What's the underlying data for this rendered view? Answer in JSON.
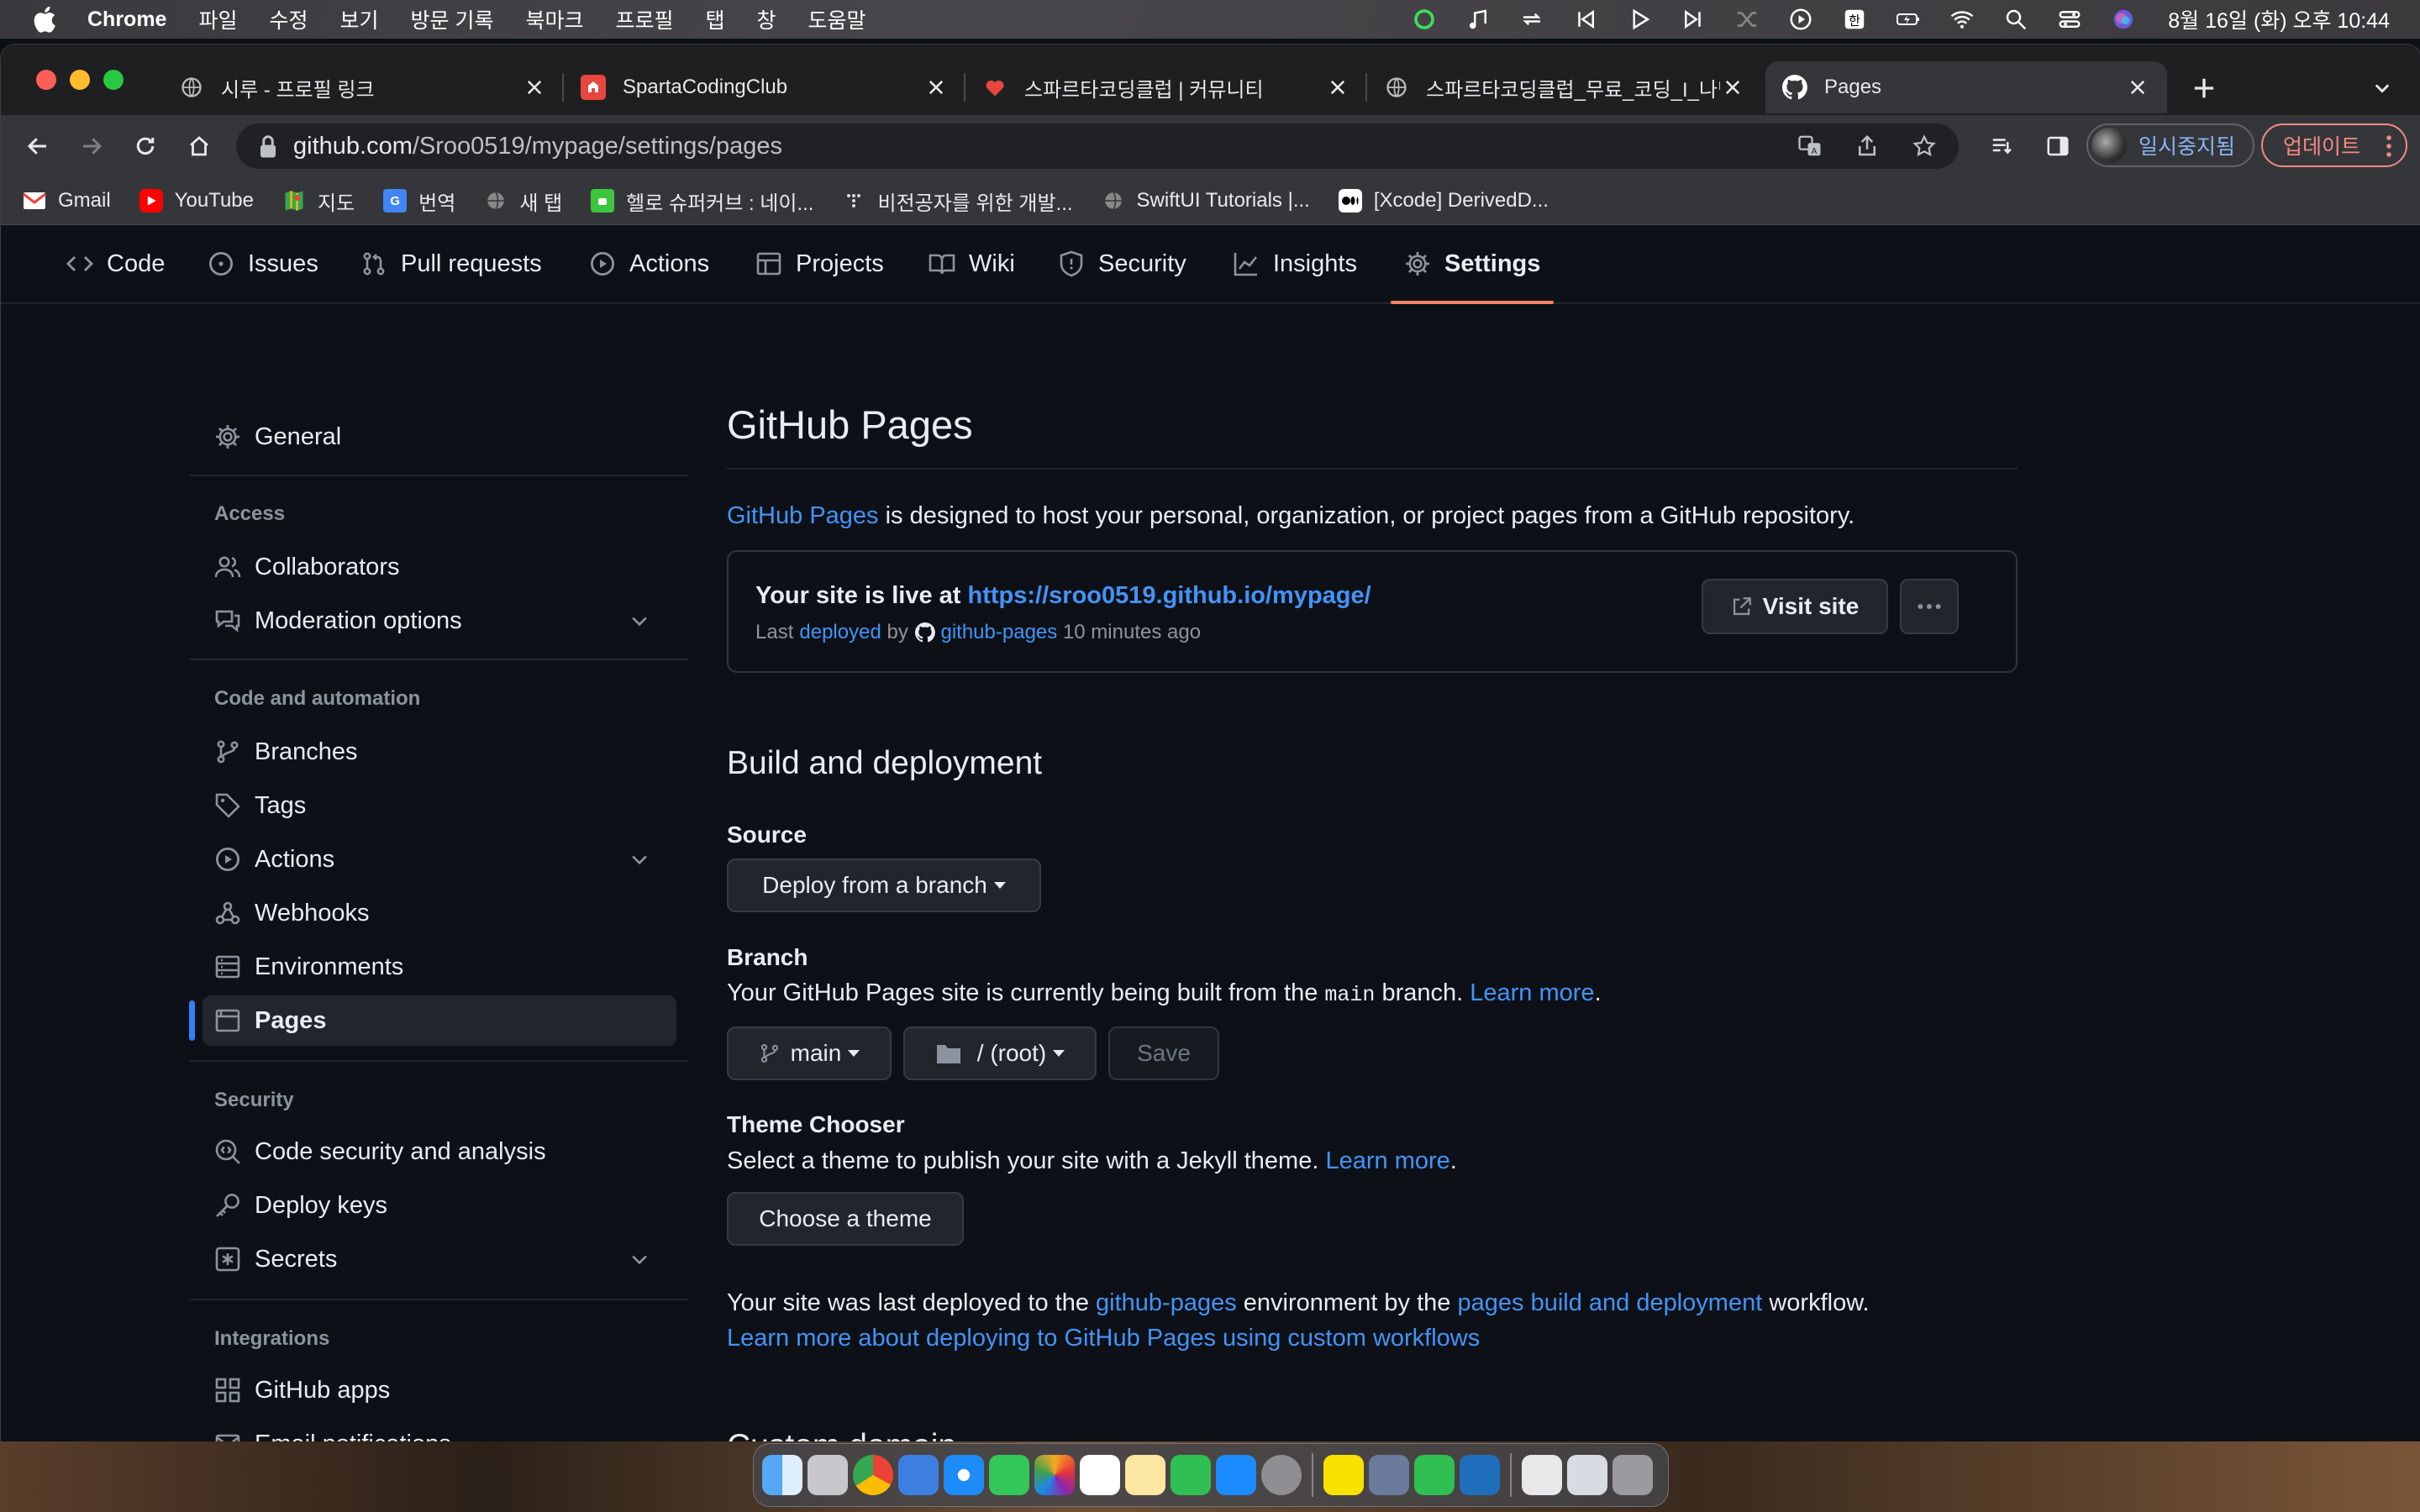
{
  "menubar": {
    "app": "Chrome",
    "items": [
      "파일",
      "수정",
      "보기",
      "방문 기록",
      "북마크",
      "프로필",
      "탭",
      "창",
      "도움말"
    ],
    "clock": "8월 16일 (화) 오후 10:44"
  },
  "tabs": [
    {
      "title": "시루 - 프로필 링크"
    },
    {
      "title": "SpartaCodingClub"
    },
    {
      "title": "스파르타코딩클럽 | 커뮤니티"
    },
    {
      "title": "스파르타코딩클럽_무료_코딩_I_나만"
    },
    {
      "title": "Pages"
    }
  ],
  "omnibox": {
    "host": "github.com",
    "path": "/Sroo0519/mypage/settings/pages"
  },
  "profile": {
    "paused_label": "일시중지됨",
    "update_label": "업데이트"
  },
  "bookmarks": [
    {
      "label": "Gmail"
    },
    {
      "label": "YouTube"
    },
    {
      "label": "지도"
    },
    {
      "label": "번역"
    },
    {
      "label": "새 탭"
    },
    {
      "label": "헬로 슈퍼커브 : 네이..."
    },
    {
      "label": "비전공자를 위한 개발..."
    },
    {
      "label": "SwiftUI Tutorials |..."
    },
    {
      "label": "[Xcode] DerivedD..."
    }
  ],
  "repo_nav": [
    "Code",
    "Issues",
    "Pull requests",
    "Actions",
    "Projects",
    "Wiki",
    "Security",
    "Insights",
    "Settings"
  ],
  "sidebar": {
    "general": "General",
    "access_heading": "Access",
    "collaborators": "Collaborators",
    "moderation": "Moderation options",
    "code_heading": "Code and automation",
    "branches": "Branches",
    "tags": "Tags",
    "actions": "Actions",
    "webhooks": "Webhooks",
    "environments": "Environments",
    "pages": "Pages",
    "security_heading": "Security",
    "code_security": "Code security and analysis",
    "deploy_keys": "Deploy keys",
    "secrets": "Secrets",
    "integrations_heading": "Integrations",
    "github_apps": "GitHub apps",
    "email_notifications": "Email notifications"
  },
  "main": {
    "title": "GitHub Pages",
    "intro_link": "GitHub Pages",
    "intro_rest": " is designed to host your personal, organization, or project pages from a GitHub repository.",
    "live_prefix": "Your site is live at ",
    "live_url": "https://sroo0519.github.io/mypage/",
    "last_prefix": "Last ",
    "last_deployed": "deployed",
    "last_by": " by ",
    "last_actor": "github-pages",
    "last_time": " 10 minutes ago",
    "visit_site": "Visit site",
    "build_title": "Build and deployment",
    "source_label": "Source",
    "source_value": "Deploy from a branch",
    "branch_label": "Branch",
    "branch_desc_1": "Your GitHub Pages site is currently being built from the ",
    "branch_code": "main",
    "branch_desc_2": " branch. ",
    "learn_more": "Learn more",
    "period": ".",
    "branch_value": "main",
    "folder_value": "/ (root)",
    "save": "Save",
    "theme_label": "Theme Chooser",
    "theme_desc": "Select a theme to publish your site with a Jekyll theme. ",
    "choose_theme": "Choose a theme",
    "deployed_1": "Your site was last deployed to the ",
    "deployed_env": "github-pages",
    "deployed_2": " environment by the ",
    "deployed_workflow": "pages build and deployment",
    "deployed_3": " workflow.",
    "custom_workflows_link": "Learn more about deploying to GitHub Pages using custom workflows",
    "custom_domain": "Custom domain"
  },
  "colors": {
    "accent_link": "#4493f8",
    "active_tab_underline": "#f78166",
    "sidebar_active_bar": "#2f81f7",
    "page_bg": "#0d1117"
  }
}
